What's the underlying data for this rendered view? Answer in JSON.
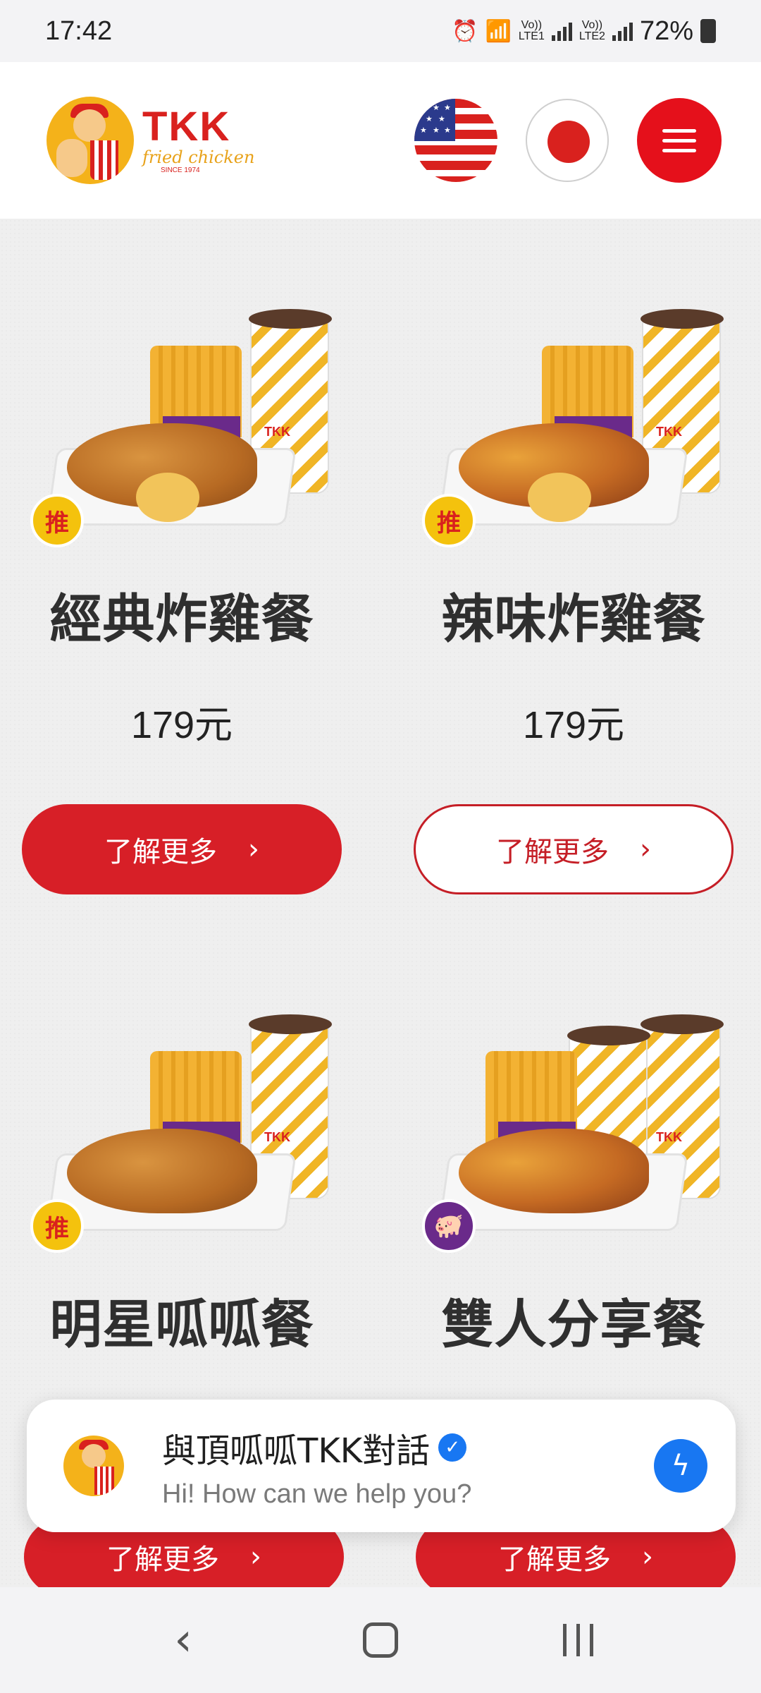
{
  "status_bar": {
    "time": "17:42",
    "battery": "72%",
    "sim1_label": "LTE1",
    "sim2_label": "LTE2",
    "volte_label": "Vo))"
  },
  "header": {
    "logo_text": "TKK",
    "logo_sub": "fried chicken",
    "logo_since": "SINCE 1974",
    "flags": [
      "us-flag-icon",
      "japan-flag-icon"
    ],
    "menu_icon": "hamburger-icon"
  },
  "products": [
    {
      "name": "經典炸雞餐",
      "price": "179元",
      "button": "了解更多",
      "badge": "推",
      "button_style": "filled"
    },
    {
      "name": "辣味炸雞餐",
      "price": "179元",
      "button": "了解更多",
      "badge": "推",
      "button_style": "outline"
    },
    {
      "name": "明星呱呱餐",
      "button": "了解更多",
      "badge": "推",
      "button_style": "filled"
    },
    {
      "name": "雙人分享餐",
      "button": "了解更多",
      "badge": "pig",
      "button_style": "filled"
    }
  ],
  "chat": {
    "title": "與頂呱呱TKK對話",
    "subtitle": "Hi! How can we help you?",
    "verified_icon": "verified-check-icon",
    "messenger_icon": "messenger-icon"
  },
  "colors": {
    "brand_red": "#d71f27",
    "menu_red": "#e5101b",
    "messenger_blue": "#1877f2"
  }
}
